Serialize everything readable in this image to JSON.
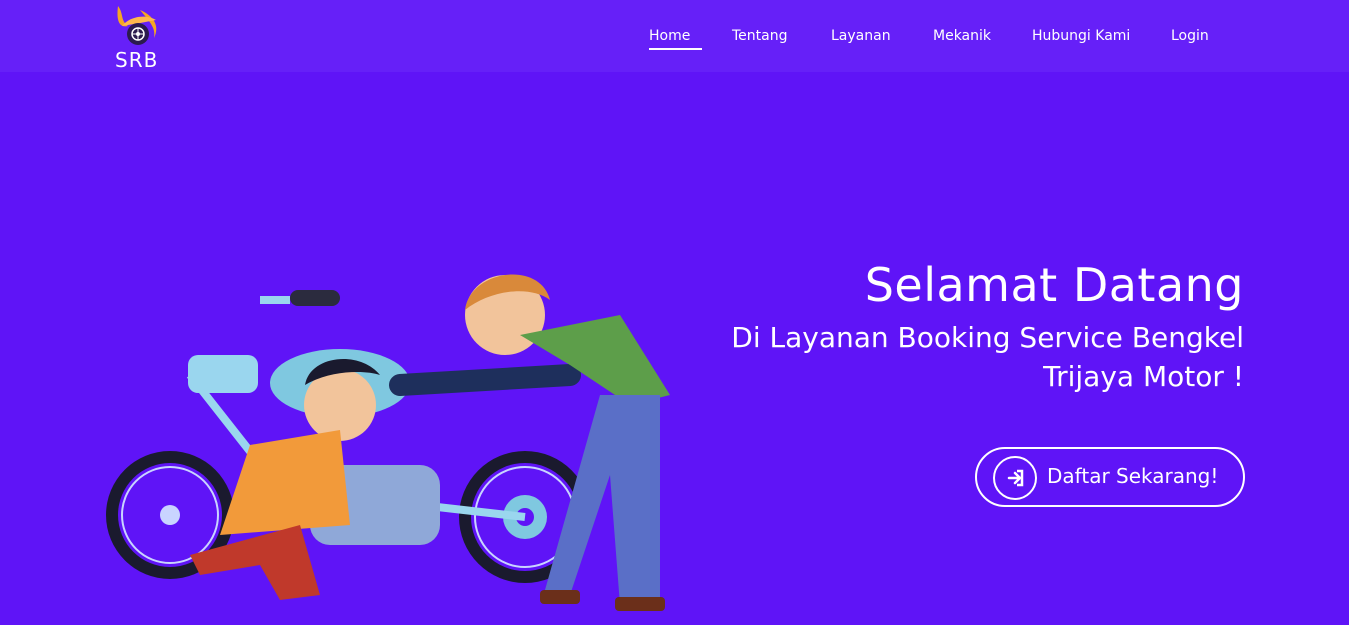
{
  "brand": {
    "logo_text": "SRB"
  },
  "nav": {
    "items": [
      {
        "label": "Home",
        "active": true
      },
      {
        "label": "Tentang"
      },
      {
        "label": "Layanan"
      },
      {
        "label": "Mekanik"
      },
      {
        "label": "Hubungi Kami"
      },
      {
        "label": "Login"
      }
    ]
  },
  "hero": {
    "title": "Selamat Datang",
    "subtitle_line1": "Di Layanan Booking Service Bengkel",
    "subtitle_line2": "Trijaya Motor !",
    "cta_label": "Daftar Sekarang!",
    "cta_icon": "sign-in-icon"
  },
  "colors": {
    "background": "#5f14f7",
    "navbar": "#6620f8",
    "text": "#ffffff",
    "logo_flame": "#f5a623"
  }
}
